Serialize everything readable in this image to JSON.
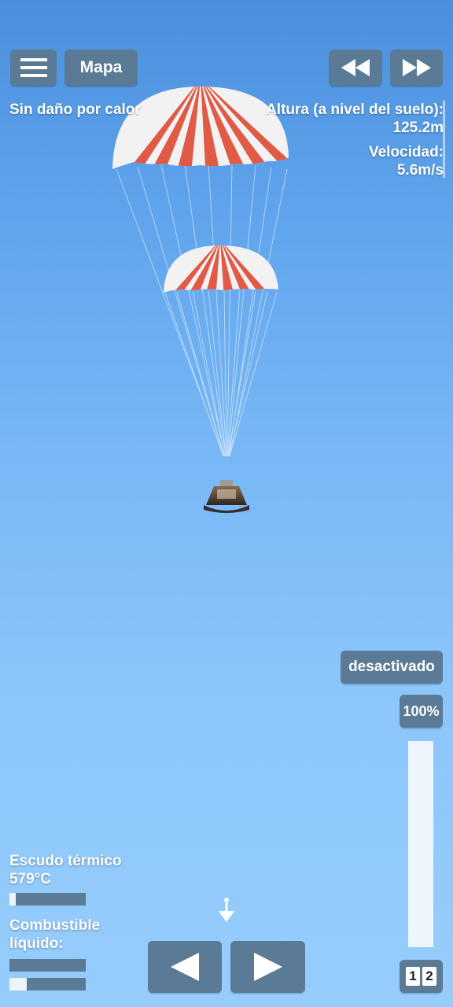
{
  "hud": {
    "map_label": "Mapa",
    "heat_status": "Sin daño por calor",
    "altitude_label": "Altura (a nivel del suelo):",
    "altitude_value": "125.2m",
    "velocity_label": "Velocidad:",
    "velocity_value": "5.6m/s",
    "menu_icon": "hamburger-menu-icon",
    "rewind_icon": "rewind-icon",
    "fast_forward_icon": "fast-forward-icon"
  },
  "controls": {
    "toggle_label": "desactivado",
    "throttle_label": "100%",
    "throttle_level": 1.0,
    "stage_digits": [
      "1",
      "2"
    ]
  },
  "resources": {
    "heat_shield_label": "Escudo térmico 579°C",
    "heat_shield_level": 0.08,
    "fuel_label": "Combustible líquido:",
    "fuel_bars": [
      0.0,
      0.23
    ]
  },
  "bottom": {
    "left_icon": "arrow-left-icon",
    "right_icon": "arrow-right-icon",
    "direction_icon": "direction-down-icon"
  },
  "colors": {
    "button": "#5a7a96",
    "parachute_red": "#e05a45",
    "parachute_white": "#f2f2f2"
  }
}
